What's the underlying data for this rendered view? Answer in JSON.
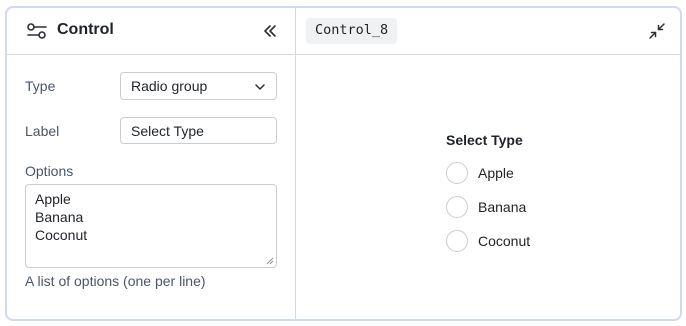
{
  "control_panel": {
    "title": "Control",
    "fields": {
      "type_label": "Type",
      "type_value": "Radio group",
      "label_label": "Label",
      "label_value": "Select Type",
      "options_label": "Options",
      "options": [
        "Apple",
        "Banana",
        "Coconut"
      ],
      "options_hint": "A list of options (one per line)"
    }
  },
  "preview_panel": {
    "tab_name": "Control_8",
    "radio_group": {
      "title": "Select Type",
      "options": [
        "Apple",
        "Banana",
        "Coconut"
      ]
    }
  },
  "icons": {
    "control": "sliders-icon",
    "collapse": "double-chevron-left-icon",
    "select": "chevron-down-icon",
    "minimize": "minimize-arrows-icon"
  },
  "colors": {
    "frame_border": "#cfd8f5",
    "divider": "#d4d9e1",
    "chip_bg": "#f0f1f3"
  }
}
